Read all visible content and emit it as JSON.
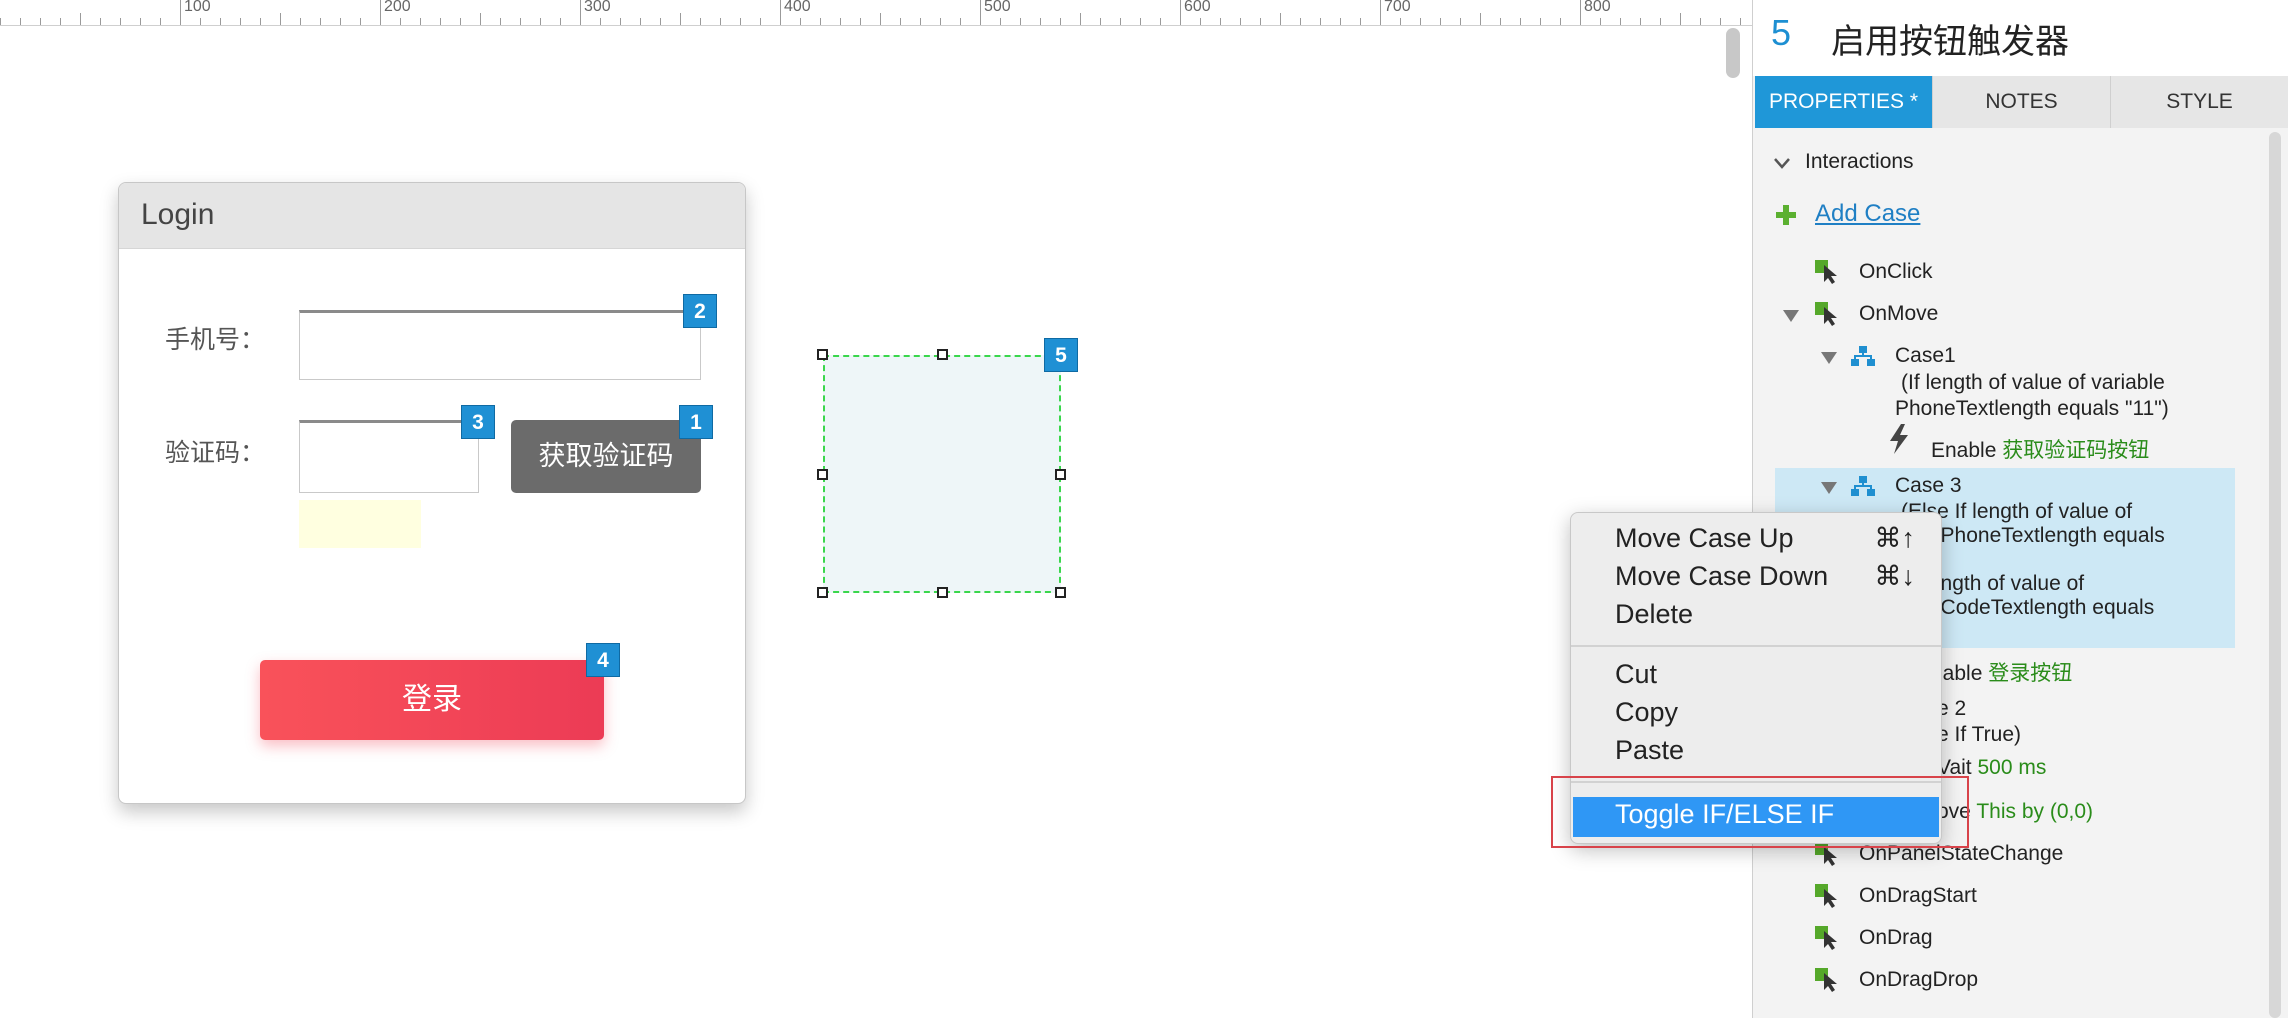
{
  "ruler": {
    "labels": [
      "100",
      "200",
      "300",
      "400",
      "500",
      "600",
      "700",
      "800"
    ]
  },
  "login": {
    "title": "Login",
    "phone_label": "手机号：",
    "code_label": "验证码：",
    "get_code_button": "获取验证码",
    "login_button": "登录",
    "badges": {
      "phone": "2",
      "code": "3",
      "get_code": "1",
      "login": "4"
    }
  },
  "hotspot": {
    "badge": "5"
  },
  "panel": {
    "widget_number": "5",
    "title": "启用按钮触发器",
    "tabs": [
      "PROPERTIES *",
      "NOTES",
      "STYLE"
    ],
    "interactions_label": "Interactions",
    "add_case": "Add Case",
    "events": {
      "onclick": "OnClick",
      "onmove": "OnMove",
      "onpanelstatechange": "OnPanelStateChange",
      "ondragstart": "OnDragStart",
      "ondrag": "OnDrag",
      "ondragdrop": "OnDragDrop"
    },
    "case1": {
      "name": "Case1",
      "cond1": "(If length of value of variable",
      "cond2": "PhoneTextlength equals \"11\")",
      "action_verb": "Enable",
      "action_target": "获取验证码按钮"
    },
    "case3": {
      "name": "Case 3",
      "line1": "(Else If length of value of",
      "line2": "able PhoneTextlength equals",
      "line3": "nd length of value of",
      "line4": "able CodeTextlength equals",
      "action_verb": "nable",
      "action_target": "登录按钮"
    },
    "case2": {
      "name": "e 2",
      "cond": "e If True)",
      "wait_verb": "Vait",
      "wait_value": "500 ms",
      "move_verb": "ove",
      "move_value": "This by (0,0)"
    }
  },
  "context_menu": {
    "items": [
      {
        "label": "Move Case Up",
        "shortcut": "⌘↑"
      },
      {
        "label": "Move Case Down",
        "shortcut": "⌘↓"
      },
      {
        "label": "Delete",
        "shortcut": ""
      },
      {
        "label": "Cut",
        "shortcut": ""
      },
      {
        "label": "Copy",
        "shortcut": ""
      },
      {
        "label": "Paste",
        "shortcut": ""
      }
    ],
    "highlighted": "Toggle IF/ELSE IF"
  },
  "colors": {
    "accent_blue": "#1f97d8",
    "menu_highlight": "#2f97f5",
    "green_text": "#2a8c1a",
    "login_red": "#f0445a",
    "callout_red": "#d8434a"
  }
}
